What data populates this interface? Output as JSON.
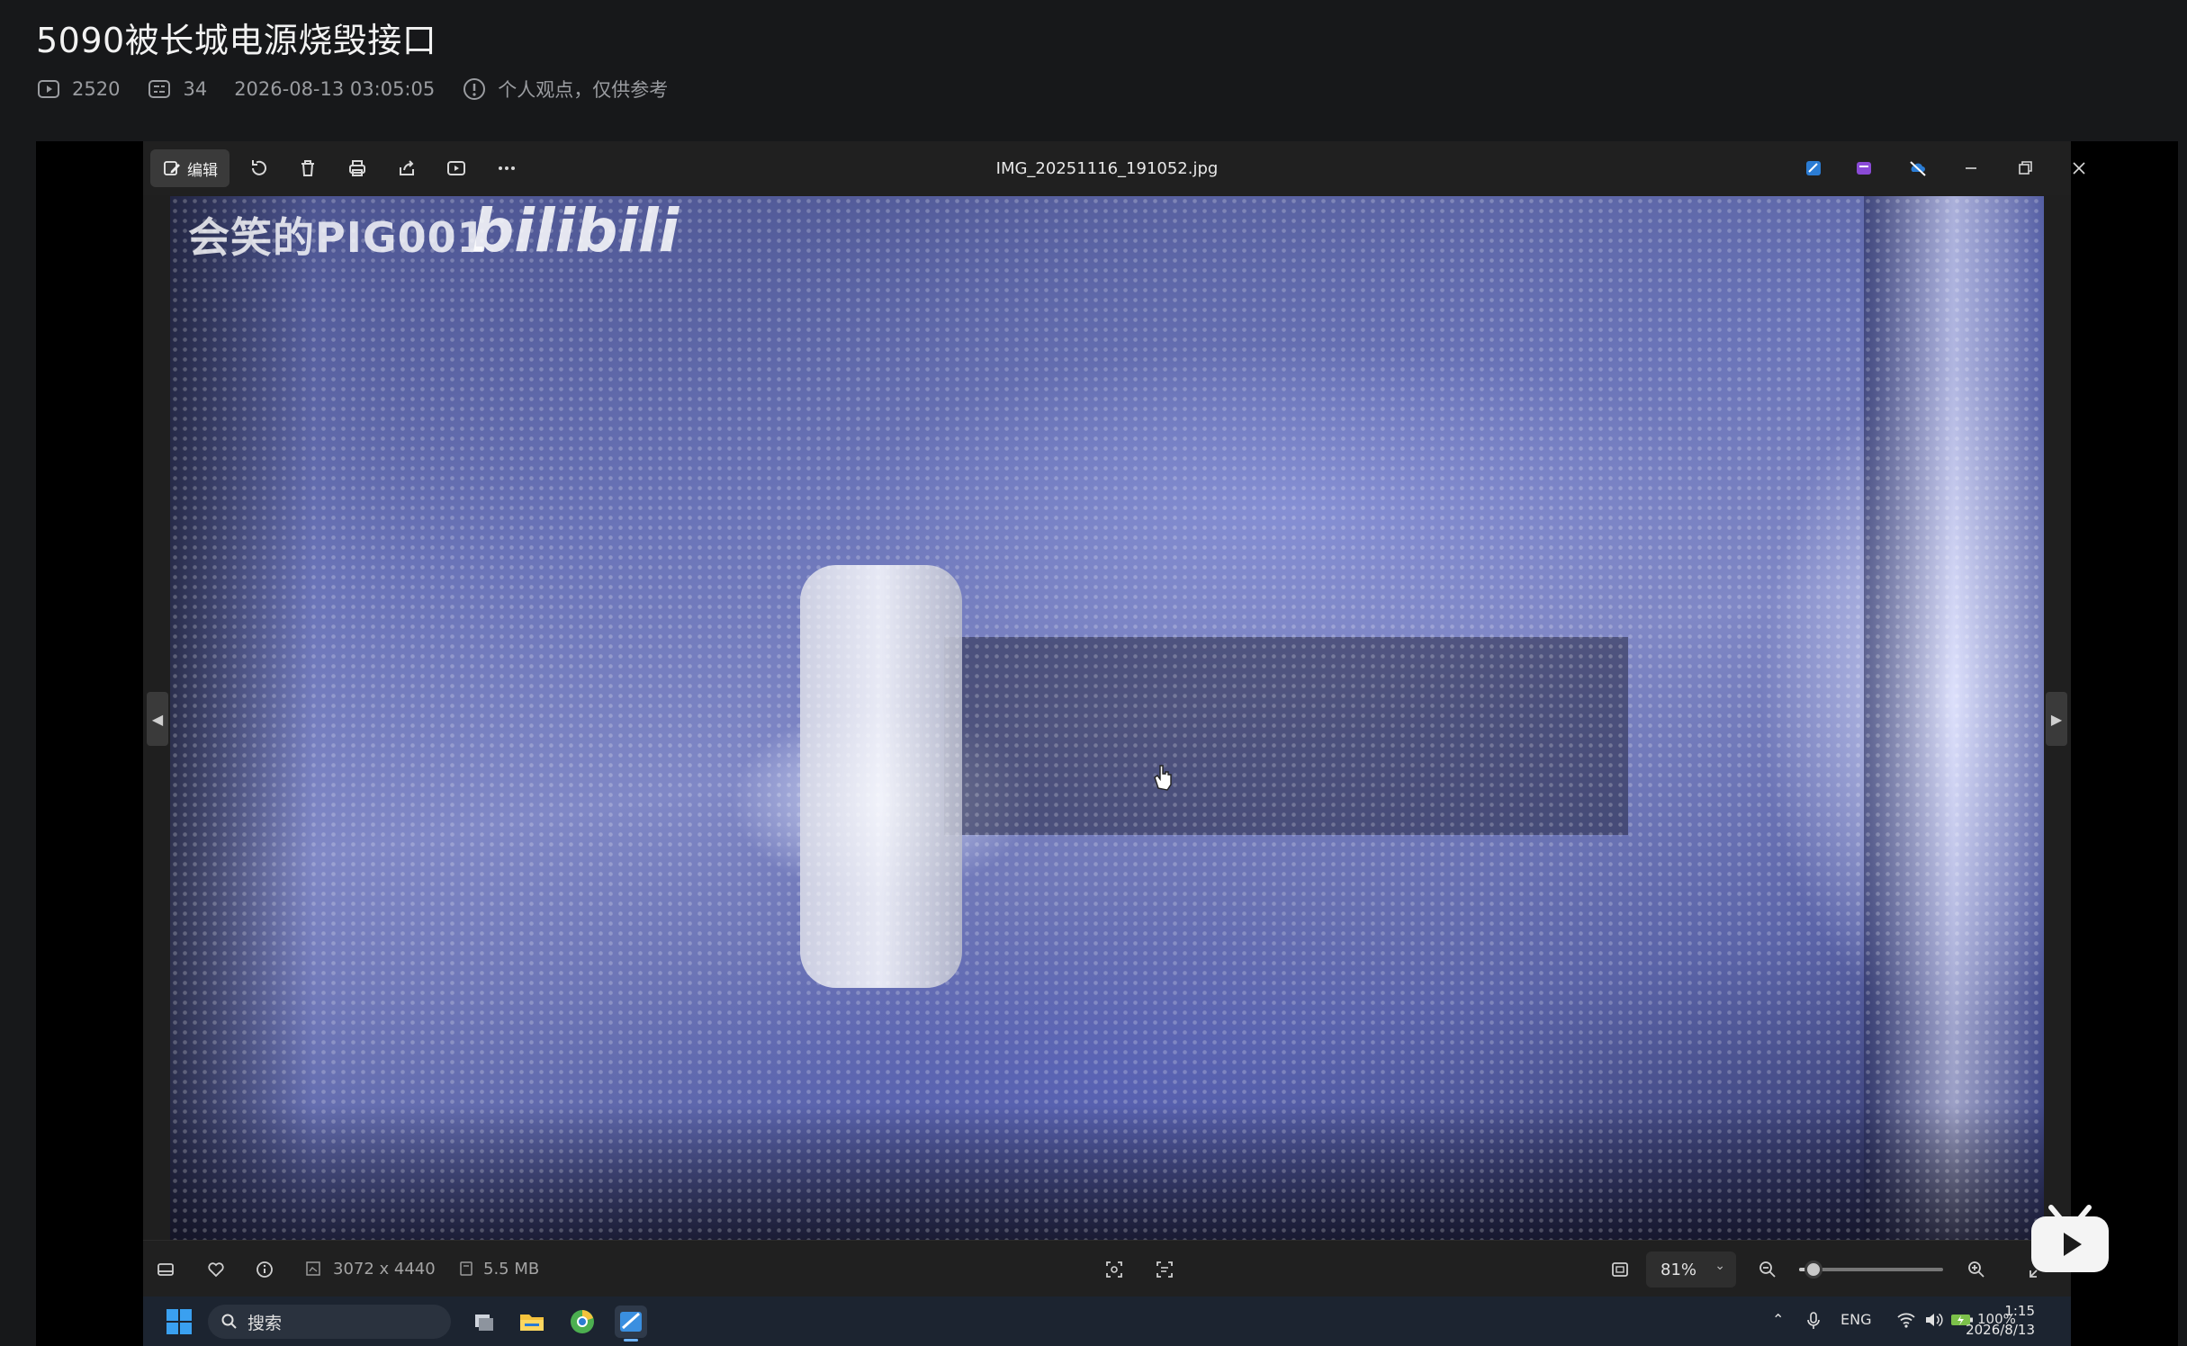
{
  "page": {
    "title": "5090被长城电源烧毁接口",
    "views": "2520",
    "danmaku": "34",
    "datetime": "2026-08-13 03:05:05",
    "notice": "个人观点，仅供参考"
  },
  "photos_window": {
    "edit_label": "编辑",
    "filename": "IMG_20251116_191052.jpg",
    "watermark_user": "会笑的PIG001",
    "watermark_brand": "bilibili",
    "dimensions": "3072 x 4440",
    "file_size": "5.5 MB",
    "zoom": "81%",
    "zoom_level": 0.1
  },
  "taskbar": {
    "search_placeholder": "搜索",
    "language": "ENG",
    "battery": "100%",
    "time": "1:15",
    "date": "2026/8/13"
  },
  "colors": {
    "bilibili_accent": "#ffffff",
    "windows_blue": "#3aa0f0"
  }
}
